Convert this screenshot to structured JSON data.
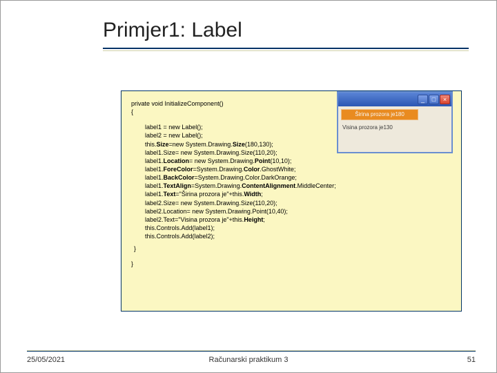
{
  "title": "Primjer1: Label",
  "code": {
    "l0a": "private void InitializeComponent()",
    "l0b": "{",
    "l1": "label1 = new Label();",
    "l2": "label2 = new Label();",
    "l3a": "this.",
    "l3b": "Size",
    "l3c": "=new System.Drawing.",
    "l3d": "Size",
    "l3e": "(180,130);",
    "l4": "label1.Size= new System.Drawing.Size(110,20);",
    "l5a": "label1.",
    "l5b": "Location",
    "l5c": "= new System.Drawing.",
    "l5d": "Point",
    "l5e": "(10,10);",
    "l6a": "label1.",
    "l6b": "ForeColor",
    "l6c": "=System.Drawing.",
    "l6d": "Color",
    "l6e": ".GhostWhite;",
    "l7a": "label1.",
    "l7b": "BackColor",
    "l7c": "=System.Drawing.Color.DarkOrange;",
    "l8a": "label1.",
    "l8b": "TextAlign",
    "l8c": "=System.Drawing.",
    "l8d": "ContentAlignment",
    "l8e": ".MiddleCenter;",
    "l9a": "label1.",
    "l9b": "Text",
    "l9c": "=\"Širina prozora je\"+this.",
    "l9d": "Width",
    "l9e": ";",
    "l10": "label2.Size= new System.Drawing.Size(110,20);",
    "l11": "label2.Location= new System.Drawing.Point(10,40);",
    "l12a": "label2.Text=\"Visina prozora je\"+this.",
    "l12b": "Height",
    "l12c": ";",
    "l13": "this.Controls.Add(label1);",
    "l14": "this.Controls.Add(label2);",
    "l15": "}",
    "l16": "}"
  },
  "window": {
    "label1": "Širina prozora je180",
    "label2": "Visina prozora je130",
    "min": "_",
    "max": "□",
    "close": "×"
  },
  "footer": {
    "date": "25/05/2021",
    "center": "Računarski praktikum 3",
    "page": "51"
  }
}
